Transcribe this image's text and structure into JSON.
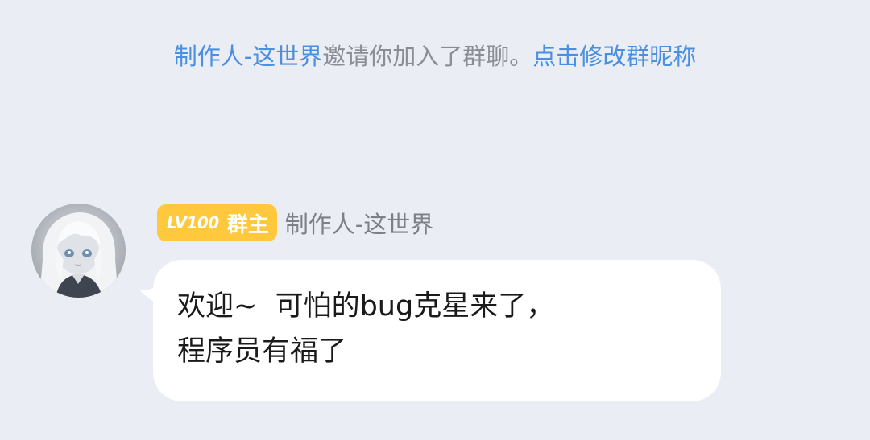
{
  "system_notice": {
    "inviter": "制作人-这世界",
    "invite_text": "邀请你加入了群聊。",
    "edit_link": "点击修改群昵称"
  },
  "message": {
    "level": "LV100",
    "role": "群主",
    "sender": "制作人-这世界",
    "lines": [
      "欢迎~  可怕的bug克星来了，",
      "程序员有福了"
    ]
  },
  "colors": {
    "background": "#ebedf5",
    "link": "#4a8fe0",
    "muted": "#8a8d93",
    "badge": "#ffc83d",
    "bubble": "#ffffff"
  }
}
